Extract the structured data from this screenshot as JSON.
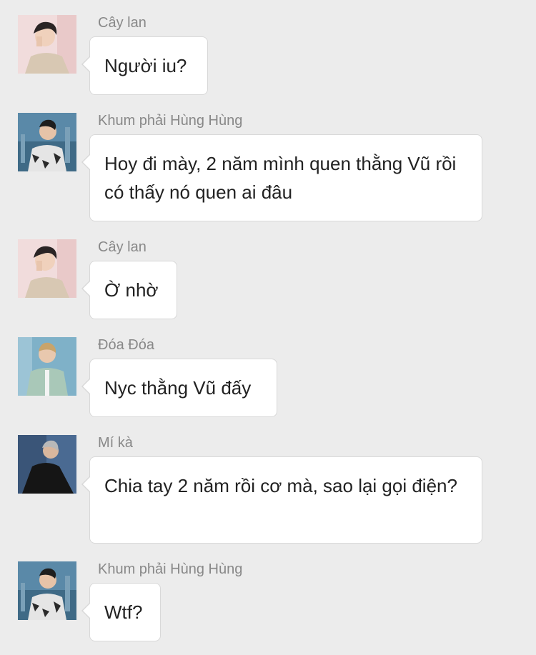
{
  "messages": [
    {
      "sender": "Cây lan",
      "text": "Người iu?",
      "avatar": "cay-lan-avatar"
    },
    {
      "sender": "Khum phải Hùng Hùng",
      "text": "Hoy đi mày, 2 năm mình quen thằng Vũ rồi có thấy nó quen ai đâu",
      "avatar": "khum-phai-hung-hung-avatar"
    },
    {
      "sender": "Cây lan",
      "text": "Ờ nhờ",
      "avatar": "cay-lan-avatar"
    },
    {
      "sender": "Đóa Đóa",
      "text": "Nyc thằng Vũ đấy",
      "avatar": "doa-doa-avatar"
    },
    {
      "sender": "Mí kà",
      "text": "Chia tay 2 năm rồi cơ mà, sao lại gọi điện?",
      "avatar": "mi-ka-avatar"
    },
    {
      "sender": "Khum phải Hùng Hùng",
      "text": "Wtf?",
      "avatar": "khum-phai-hung-hung-avatar"
    }
  ],
  "colors": {
    "background": "#ececec",
    "bubble": "#ffffff",
    "bubble_border": "#d8d8d8",
    "sender_text": "#888888",
    "message_text": "#222222"
  }
}
